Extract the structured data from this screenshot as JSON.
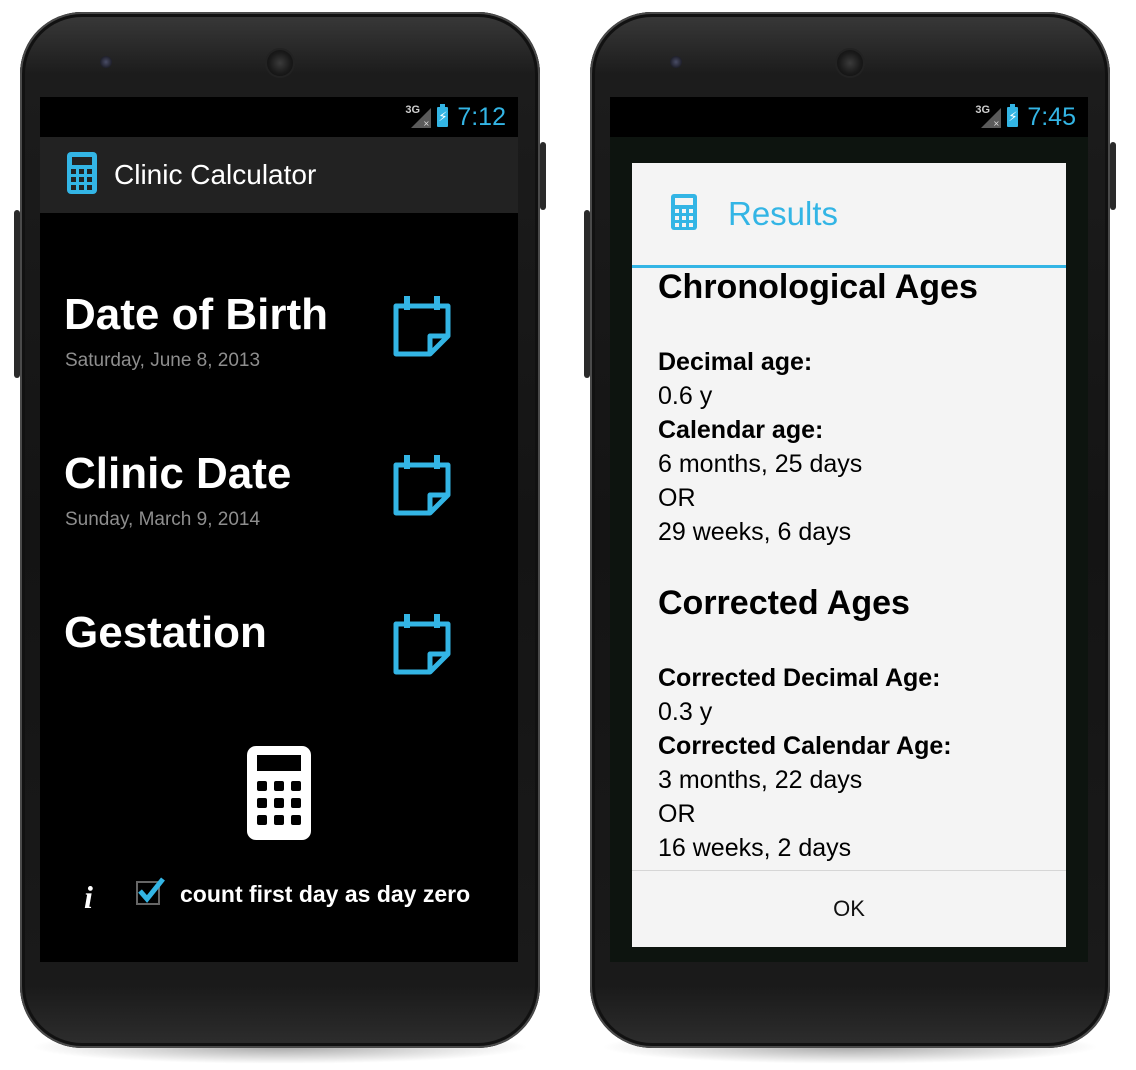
{
  "left_phone": {
    "status_bar": {
      "network": "3G",
      "time": "7:12"
    },
    "action_bar": {
      "title": "Clinic Calculator",
      "icon": "calculator-icon"
    },
    "fields": [
      {
        "title": "Date of Birth",
        "subtitle": "Saturday, June 8, 2013",
        "icon": "calendar-icon"
      },
      {
        "title": "Clinic Date",
        "subtitle": "Sunday, March 9, 2014",
        "icon": "calendar-icon"
      },
      {
        "title": "Gestation",
        "subtitle": "",
        "icon": "calendar-icon"
      }
    ],
    "calculate_icon": "calculator-icon",
    "info_icon": "i",
    "checkbox": {
      "label": "count first day as day zero",
      "checked": true
    }
  },
  "right_phone": {
    "status_bar": {
      "network": "3G",
      "time": "7:45"
    },
    "dialog": {
      "title": "Results",
      "icon": "calculator-icon",
      "sections": [
        {
          "heading": "Chronological Ages",
          "decimal_label": "Decimal age:",
          "decimal_value": "0.6 y",
          "calendar_label": "Calendar age:",
          "calendar_value": "6 months, 25 days",
          "or": "OR",
          "weeks_value": "29 weeks, 6 days"
        },
        {
          "heading": "Corrected Ages",
          "decimal_label": "Corrected Decimal Age:",
          "decimal_value": "0.3 y",
          "calendar_label": "Corrected Calendar Age:",
          "calendar_value": "3 months, 22 days",
          "or": "OR",
          "weeks_value": "16 weeks, 2 days"
        }
      ],
      "ok_label": "OK"
    }
  },
  "colors": {
    "accent": "#33b5e5",
    "action_bar": "#222222",
    "dialog_bg": "#f4f4f4",
    "subtitle": "#8e8e8e"
  }
}
